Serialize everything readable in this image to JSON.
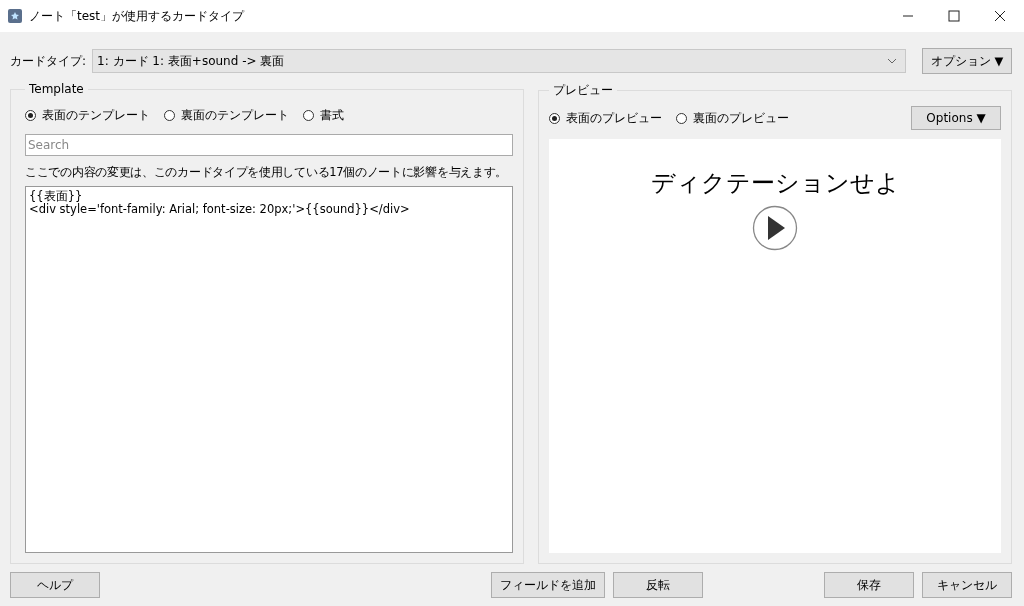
{
  "window": {
    "title": "ノート「test」が使用するカードタイプ"
  },
  "card_type": {
    "label": "カードタイプ:",
    "value": "1: カード 1: 表面+sound -> 裏面",
    "options_button": "オプション ▼"
  },
  "template": {
    "title": "Template",
    "radios": [
      {
        "label": "表面のテンプレート",
        "selected": true
      },
      {
        "label": "裏面のテンプレート",
        "selected": false
      },
      {
        "label": "書式",
        "selected": false
      }
    ],
    "search": {
      "placeholder": "Search"
    },
    "notice": "ここでの内容の変更は、このカードタイプを使用している17個のノートに影響を与えます。",
    "editor_lines": [
      "{{表面}}",
      "<div style='font-family: Arial; font-size: 20px;'>{{sound}}</div>"
    ]
  },
  "preview": {
    "title": "プレビュー",
    "radios": [
      {
        "label": "表面のプレビュー",
        "selected": true
      },
      {
        "label": "裏面のプレビュー",
        "selected": false
      }
    ],
    "options_button": "Options ▼",
    "card_text": "ディクテーションせよ"
  },
  "buttons": {
    "left": [
      "ヘルプ"
    ],
    "center": [
      "フィールドを追加",
      "反転"
    ],
    "right": [
      "保存",
      "キャンセル"
    ]
  }
}
